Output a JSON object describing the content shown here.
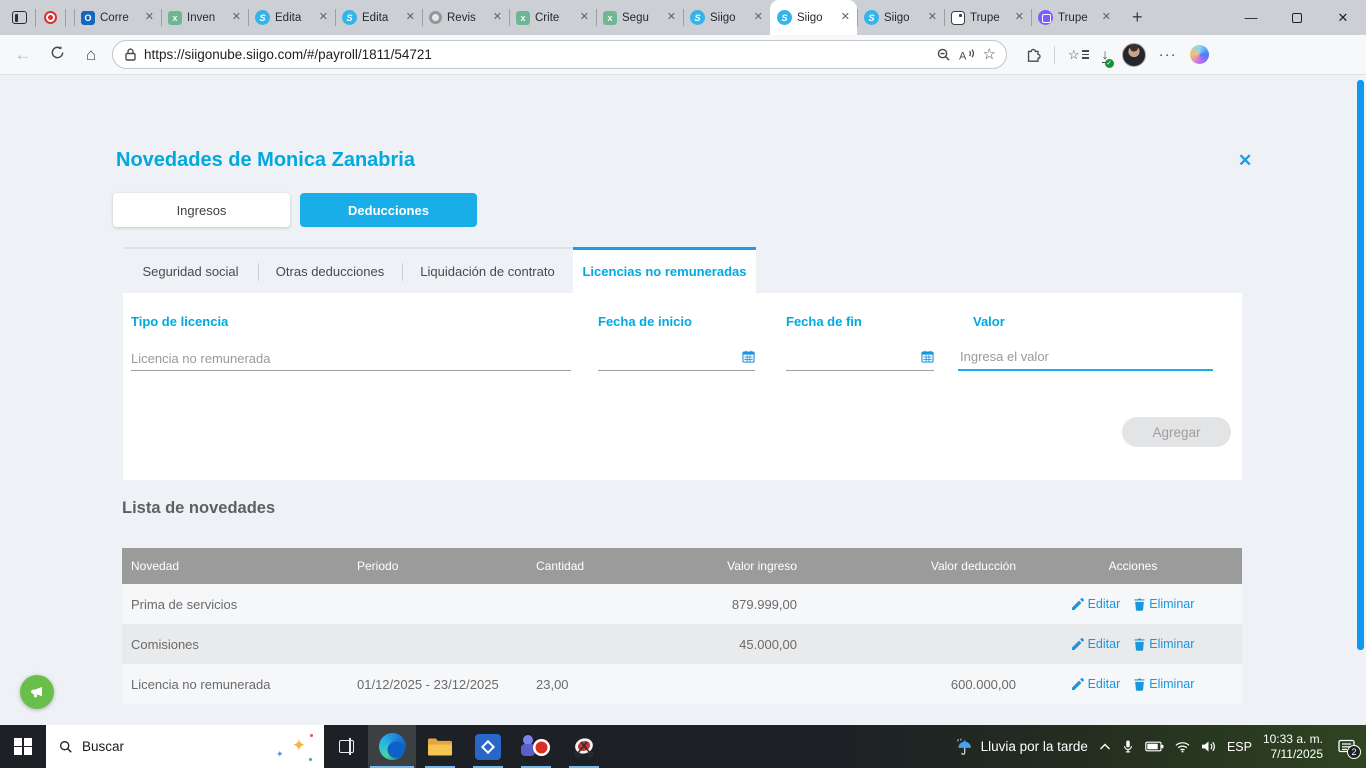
{
  "browser": {
    "url": "https://siigonube.siigo.com/#/payroll/1811/54721",
    "tabs": [
      {
        "label": "Corre",
        "icon": "outlook"
      },
      {
        "label": "Inven",
        "icon": "excel"
      },
      {
        "label": "Edita",
        "icon": "siigo"
      },
      {
        "label": "Edita",
        "icon": "siigo"
      },
      {
        "label": "Revis",
        "icon": "chatgpt"
      },
      {
        "label": "Crite",
        "icon": "excel"
      },
      {
        "label": "Segu",
        "icon": "excel"
      },
      {
        "label": "Siigo",
        "icon": "siigo"
      },
      {
        "label": "Siigo",
        "icon": "siigo",
        "active": true
      },
      {
        "label": "Siigo",
        "icon": "siigo"
      },
      {
        "label": "Trupe",
        "icon": "trupe-light"
      },
      {
        "label": "Trupe",
        "icon": "trupe-purple"
      }
    ]
  },
  "page": {
    "title": "Novedades de Monica Zanabria",
    "toggles": [
      {
        "label": "Ingresos"
      },
      {
        "label": "Deducciones"
      }
    ],
    "subtabs": [
      {
        "label": "Seguridad social"
      },
      {
        "label": "Otras deducciones"
      },
      {
        "label": "Liquidación de contrato"
      },
      {
        "label": "Licencias no remuneradas"
      }
    ],
    "form": {
      "fields": [
        {
          "label": "Tipo de licencia",
          "value": "Licencia no remunerada"
        },
        {
          "label": "Fecha de inicio",
          "value": ""
        },
        {
          "label": "Fecha de fin",
          "value": ""
        },
        {
          "label": "Valor",
          "placeholder": "Ingresa el valor"
        }
      ],
      "add_button_label": "Agregar"
    },
    "list": {
      "heading": "Lista de novedades",
      "columns": [
        "Novedad",
        "Periodo",
        "Cantidad",
        "Valor ingreso",
        "Valor deducción",
        "Acciones"
      ],
      "rows": [
        {
          "novedad": "Prima de servicios",
          "periodo": "",
          "cantidad": "",
          "valor_ingreso": "879.999,00",
          "valor_deduccion": ""
        },
        {
          "novedad": "Comisiones",
          "periodo": "",
          "cantidad": "",
          "valor_ingreso": "45.000,00",
          "valor_deduccion": ""
        },
        {
          "novedad": "Licencia no remunerada",
          "periodo": "01/12/2025 - 23/12/2025",
          "cantidad": "23,00",
          "valor_ingreso": "",
          "valor_deduccion": "600.000,00"
        }
      ],
      "edit_label": "Editar",
      "delete_label": "Eliminar"
    }
  },
  "taskbar": {
    "search_placeholder": "Buscar",
    "weather_text": "Lluvia por la tarde",
    "language_label": "ESP",
    "time": "10:33 a. m.",
    "date": "7/11/2025",
    "notification_count": "2"
  },
  "colors": {
    "accent_blue": "#1aaee8",
    "label_blue": "#00a9e0",
    "table_header_gray": "#9b9b9b",
    "fab_green": "#6abf4b",
    "scrollbar_blue": "#0d99f2"
  }
}
